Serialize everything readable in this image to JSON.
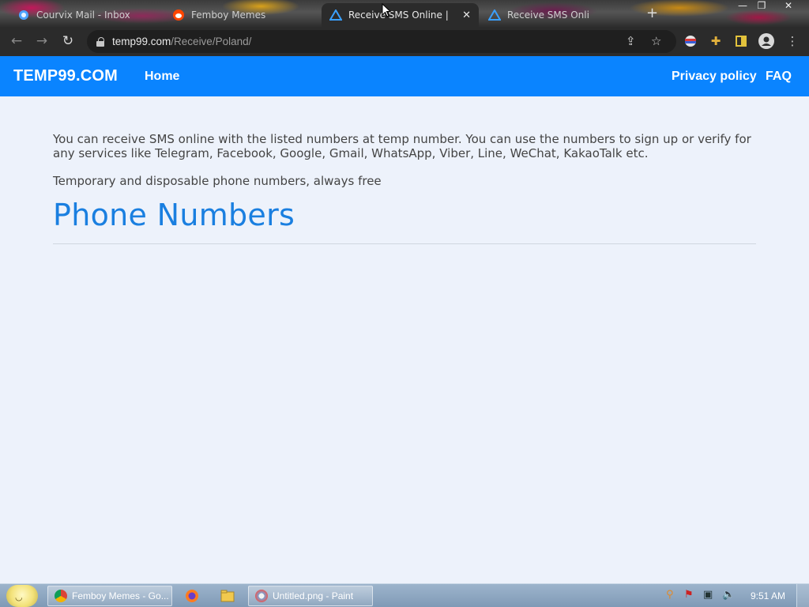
{
  "browser": {
    "tabs": [
      {
        "title": "Courvix Mail - Inbox",
        "favicon": "courvix-icon",
        "close": "✕"
      },
      {
        "title": "Femboy Memes",
        "favicon": "reddit-icon",
        "close": "✕"
      },
      {
        "title": "Receive SMS Online | Tem",
        "favicon": "temp99-triangle-icon",
        "close": "✕"
      },
      {
        "title": "Receive SMS Onli",
        "favicon": "temp99-triangle-icon",
        "close": "✕"
      }
    ],
    "url_host": "temp99.com",
    "url_path": "/Receive/Poland/"
  },
  "site": {
    "brand": "TEMP99.COM",
    "nav": {
      "home": "Home",
      "privacy": "Privacy policy",
      "faq": "FAQ"
    },
    "intro": "You can receive SMS online with the listed numbers at temp number. You can use the numbers to sign up or verify for any services like Telegram, Facebook, Google, Gmail, WhatsApp, Viber, Line, WeChat, KakaoTalk etc.",
    "tagline": "Temporary and disposable phone numbers, always free",
    "heading": "Phone Numbers",
    "accent": "#0a84ff",
    "heading_color": "#1a7fe0"
  },
  "taskbar": {
    "tasks": [
      {
        "label": "Femboy Memes - Go...",
        "icon": "chrome-icon"
      },
      {
        "label": "Untitled.png - Paint",
        "icon": "paint-icon"
      }
    ],
    "clock": "9:51 AM"
  }
}
